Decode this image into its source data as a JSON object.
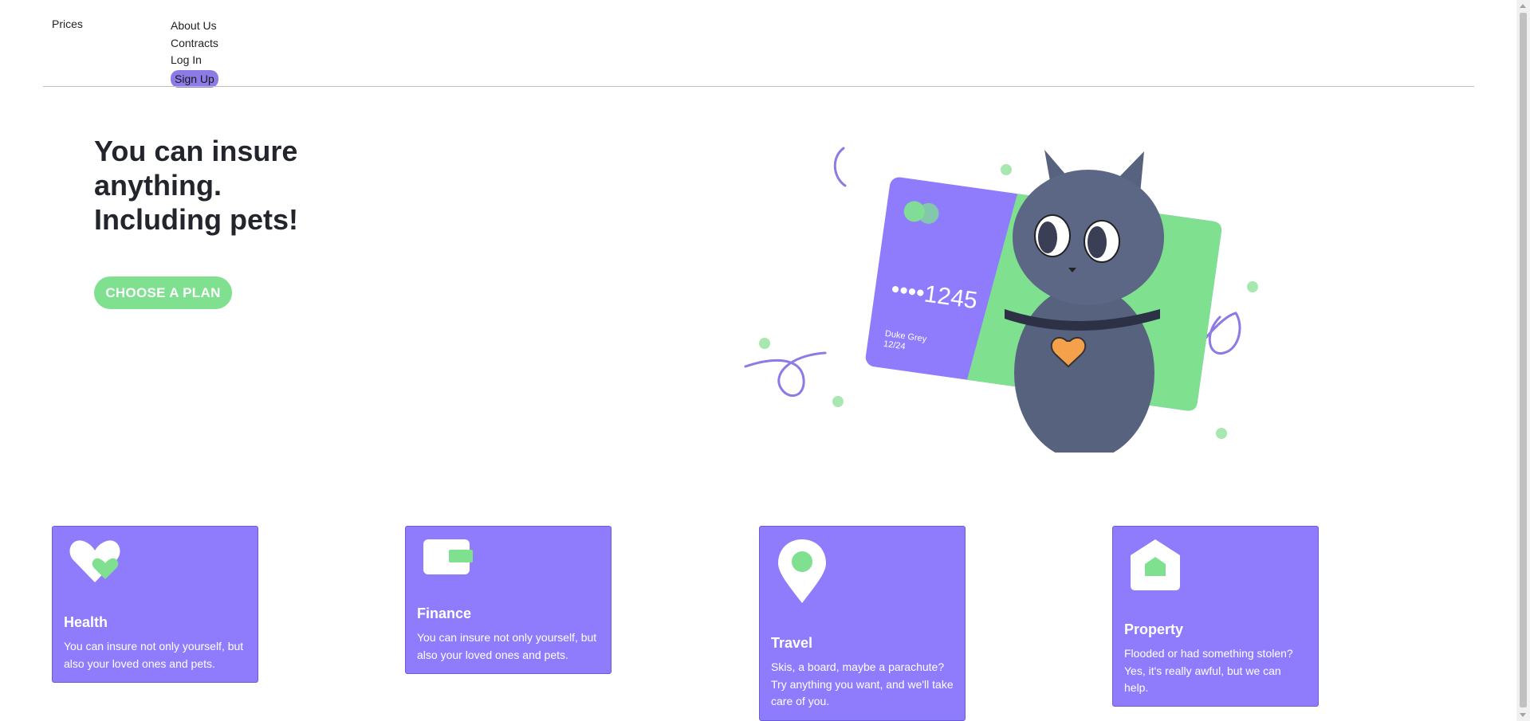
{
  "nav": {
    "prices": "Prices",
    "about": "About Us",
    "contracts": "Contracts",
    "login": "Log In",
    "signup": "Sign Up"
  },
  "hero": {
    "title_line1": "You can insure",
    "title_line2": "anything.",
    "title_line3": "Including pets!",
    "cta": "CHOOSE A PLAN",
    "card_number": "••••1245",
    "card_holder": "Duke Grey",
    "card_expiry": "12/24"
  },
  "cards": [
    {
      "title": "Health",
      "text": "You can insure not only yourself, but also your loved ones and pets.",
      "icon": "heart-icon"
    },
    {
      "title": "Finance",
      "text": "You can insure not only yourself, but also your loved ones and pets.",
      "icon": "wallet-icon"
    },
    {
      "title": "Travel",
      "text": "Skis, a board, maybe a parachute? Try anything you want, and we'll take care of you.",
      "icon": "location-pin-icon"
    },
    {
      "title": "Property",
      "text": "Flooded or had something stolen? Yes, it's really awful, but we can help.",
      "icon": "house-icon"
    }
  ],
  "colors": {
    "accent_purple": "#8f7cfd",
    "accent_green": "#7fe190",
    "text_dark": "#23252d"
  }
}
